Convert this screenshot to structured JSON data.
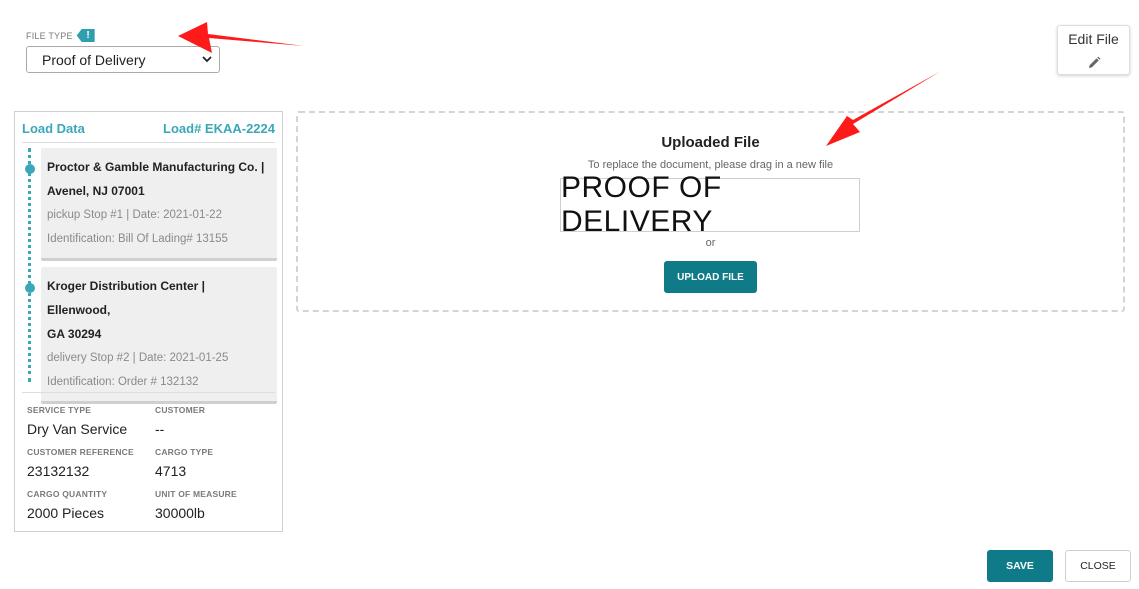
{
  "file_type": {
    "label": "FILE TYPE",
    "warning_icon": "exclamation-tag-icon",
    "selected": "Proof of Delivery"
  },
  "edit_file": {
    "label": "Edit File",
    "icon": "pencil-icon"
  },
  "load_panel": {
    "title": "Load Data",
    "load_number": "Load# EKAA-2224",
    "stops": [
      {
        "name_line1": "Proctor & Gamble Manufacturing Co. |",
        "name_line2": "Avenel, NJ 07001",
        "meta": "pickup Stop #1 | Date: 2021-01-22",
        "identification": "Identification: Bill Of Lading# 13155"
      },
      {
        "name_line1": "Kroger Distribution Center | Ellenwood,",
        "name_line2": "GA 30294",
        "meta": "delivery Stop #2 | Date: 2021-01-25",
        "identification": "Identification: Order # 132132"
      }
    ],
    "fields": {
      "service_type_label": "SERVICE TYPE",
      "service_type": "Dry Van Service",
      "customer_label": "CUSTOMER",
      "customer": "--",
      "customer_reference_label": "CUSTOMER REFERENCE",
      "customer_reference": "23132132",
      "cargo_type_label": "CARGO TYPE",
      "cargo_type": "4713",
      "cargo_quantity_label": "CARGO QUANTITY",
      "cargo_quantity": "2000 Pieces",
      "unit_of_measure_label": "UNIT OF MEASURE",
      "unit_of_measure": "30000lb"
    }
  },
  "upload": {
    "title": "Uploaded File",
    "subtitle": "To replace the document, please drag in a new file",
    "preview_text": "PROOF OF DELIVERY",
    "or_text": "or",
    "button": "UPLOAD FILE"
  },
  "footer": {
    "save": "SAVE",
    "close": "CLOSE"
  },
  "colors": {
    "accent": "#3aa8b8",
    "button": "#0f7b88",
    "annotation_arrow": "#ff1a1a"
  }
}
